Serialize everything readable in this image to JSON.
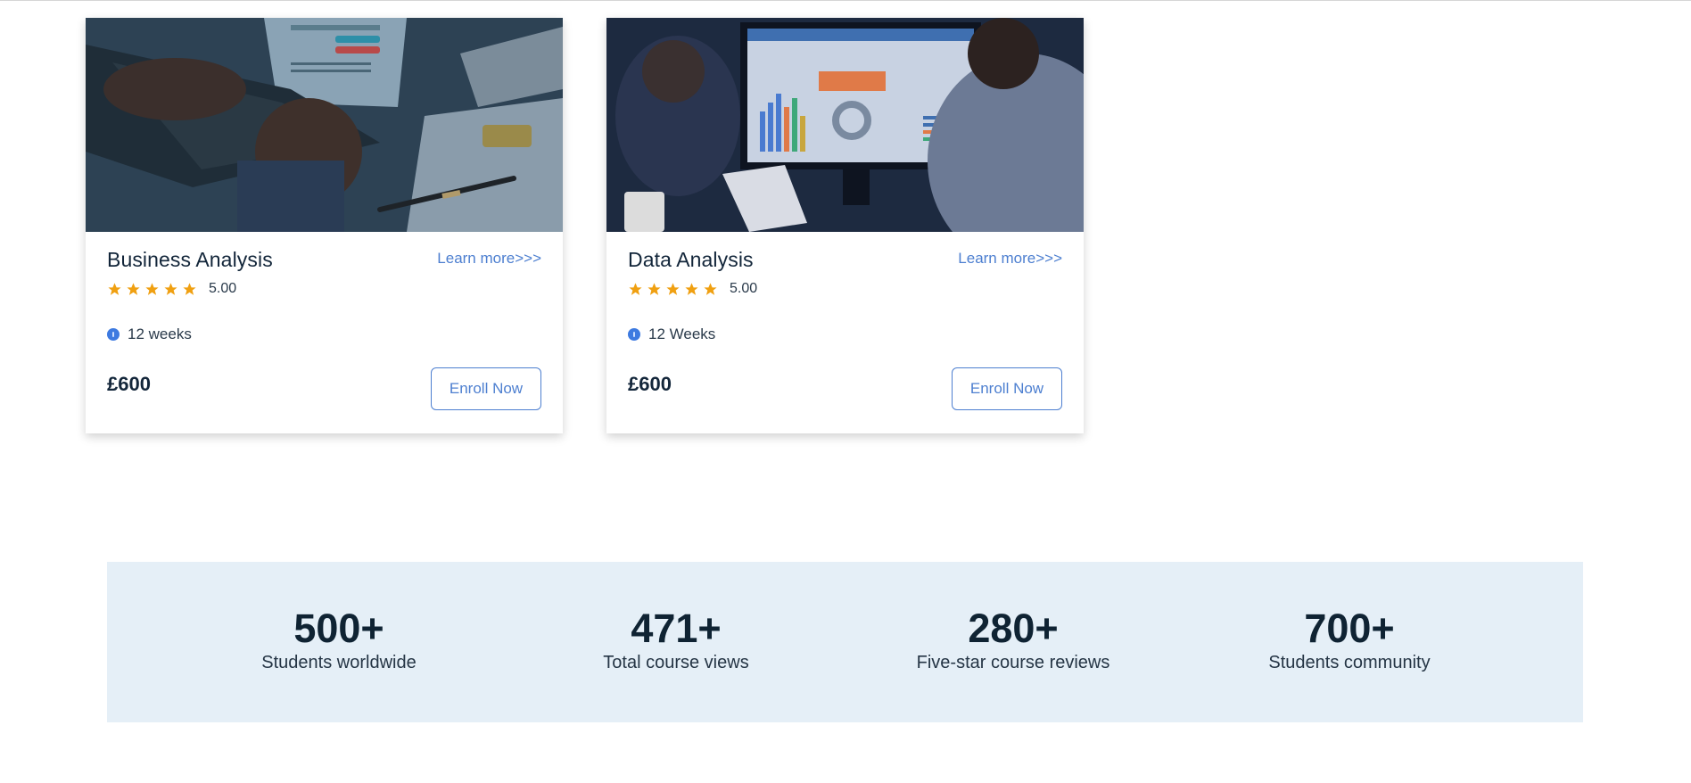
{
  "courses": [
    {
      "title": "Business Analysis",
      "learn_more": "Learn more>>>",
      "rating": "5.00",
      "stars": 5,
      "duration": "12 weeks",
      "price": "£600",
      "enroll": "Enroll Now"
    },
    {
      "title": "Data Analysis",
      "learn_more": "Learn more>>>",
      "rating": "5.00",
      "stars": 5,
      "duration": "12 Weeks",
      "price": "£600",
      "enroll": "Enroll Now"
    }
  ],
  "stats": [
    {
      "value": "500+",
      "label": "Students worldwide"
    },
    {
      "value": "471+",
      "label": "Total course views"
    },
    {
      "value": "280+",
      "label": "Five-star course reviews"
    },
    {
      "value": "700+",
      "label": "Students community"
    }
  ],
  "colors": {
    "accent": "#4d7fd0",
    "star": "#f0a011",
    "stats_bg": "#e5eff7",
    "text_dark": "#0f2333"
  },
  "icons": {
    "star": "star-icon",
    "duration": "clock-icon"
  }
}
